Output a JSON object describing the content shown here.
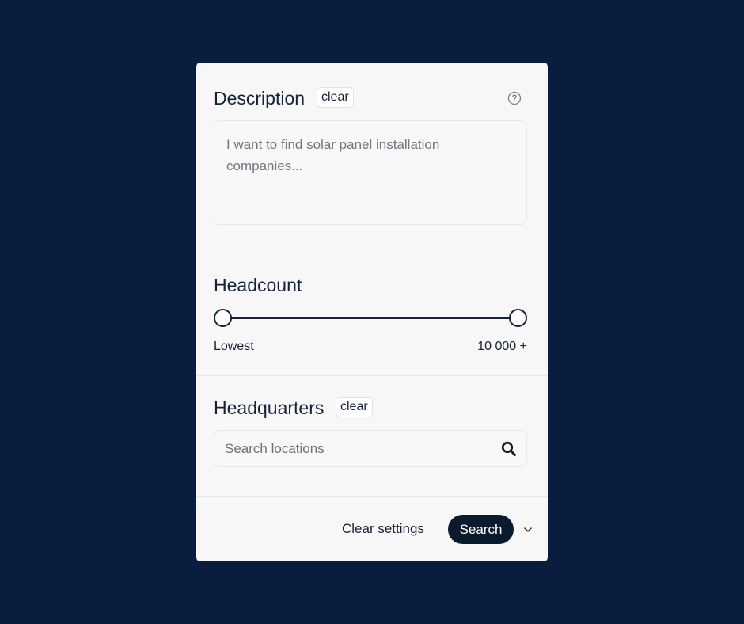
{
  "description": {
    "title": "Description",
    "clear_label": "clear",
    "placeholder": "I want to find solar panel installation companies...",
    "help_icon": "question-circle-icon"
  },
  "headcount": {
    "title": "Headcount",
    "min_label": "Lowest",
    "max_label": "10 000 +",
    "range_low_fraction": 0,
    "range_high_fraction": 1
  },
  "headquarters": {
    "title": "Headquarters",
    "clear_label": "clear",
    "search_placeholder": "Search locations",
    "search_icon": "magnifier-icon"
  },
  "footer": {
    "clear_settings_label": "Clear settings",
    "search_label": "Search",
    "chevron_icon": "chevron-down-icon"
  },
  "colors": {
    "background": "#0b1d3f",
    "panel": "#f7f7f7",
    "text": "#152238",
    "button_dark": "#0c1a2e"
  }
}
